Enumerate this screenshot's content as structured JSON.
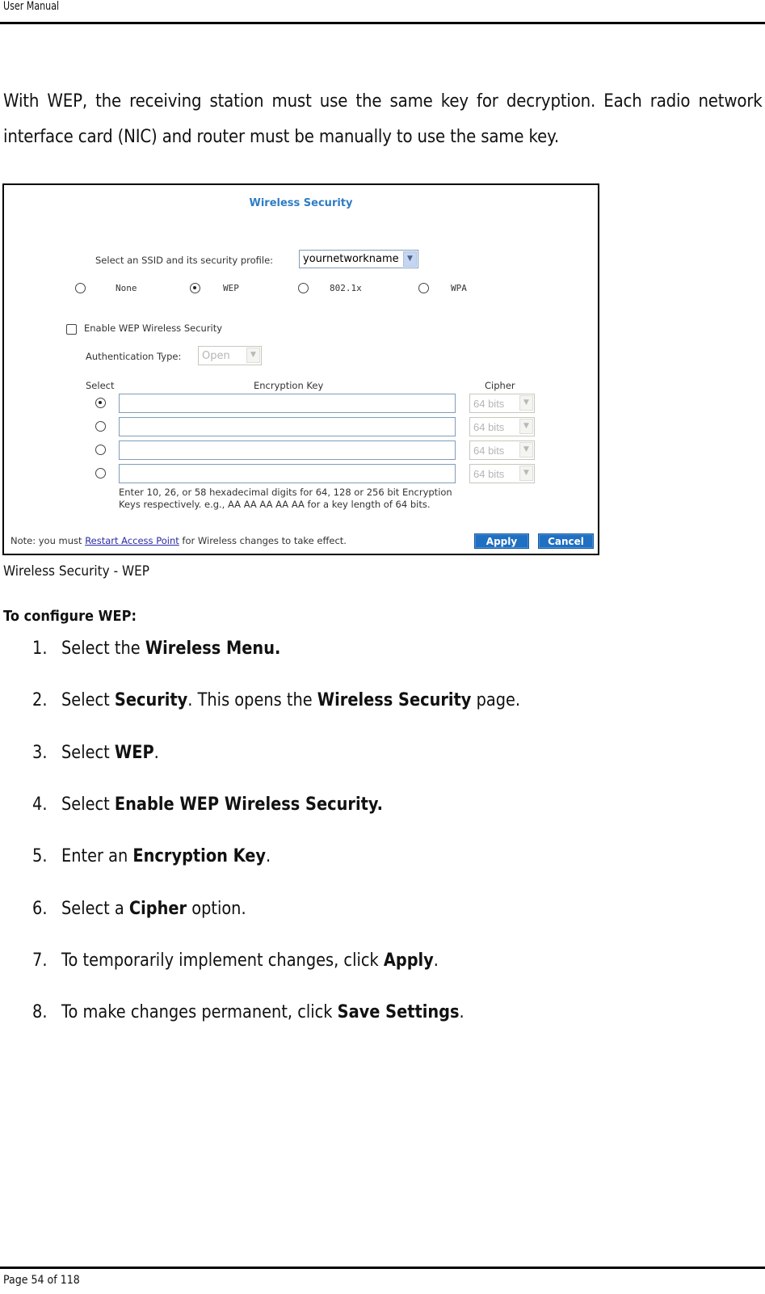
{
  "header": {
    "title": "User Manual"
  },
  "intro": "With WEP, the receiving station must use the same key for decryption. Each radio network interface card (NIC) and router must be manually to use the same key.",
  "screenshot": {
    "title": "Wireless Security",
    "ssid_label": "Select an SSID and its security profile:",
    "ssid_value": "yournetworkname",
    "security_modes": [
      {
        "label": "None",
        "checked": false
      },
      {
        "label": "WEP",
        "checked": true
      },
      {
        "label": "802.1x",
        "checked": false
      },
      {
        "label": "WPA",
        "checked": false
      }
    ],
    "enable_label": "Enable WEP Wireless Security",
    "enable_checked": false,
    "auth_label": "Authentication Type:",
    "auth_value": "Open",
    "columns": {
      "select": "Select",
      "key": "Encryption Key",
      "cipher": "Cipher"
    },
    "keys": [
      {
        "selected": true,
        "value": "",
        "cipher": "64 bits"
      },
      {
        "selected": false,
        "value": "",
        "cipher": "64 bits"
      },
      {
        "selected": false,
        "value": "",
        "cipher": "64 bits"
      },
      {
        "selected": false,
        "value": "",
        "cipher": "64 bits"
      }
    ],
    "hint": "Enter 10, 26, or 58 hexadecimal digits for 64, 128 or 256 bit Encryption Keys respectively. e.g., AA AA AA AA AA for a key length of 64 bits.",
    "note_prefix": "Note: you must ",
    "note_link": "Restart Access Point",
    "note_suffix": " for Wireless changes to take effect.",
    "apply_label": "Apply",
    "cancel_label": "Cancel",
    "accent_color": "#2f7cc4",
    "button_color": "#1f6fc2"
  },
  "caption": "Wireless Security - WEP",
  "subhead": "To configure WEP:",
  "steps": [
    {
      "num": "1.",
      "parts": [
        {
          "t": "Select the "
        },
        {
          "t": "Wireless Menu.",
          "b": true
        }
      ]
    },
    {
      "num": "2.",
      "parts": [
        {
          "t": "Select "
        },
        {
          "t": "Security",
          "b": true
        },
        {
          "t": ". This opens the "
        },
        {
          "t": "Wireless Security",
          "b": true
        },
        {
          "t": " page."
        }
      ]
    },
    {
      "num": "3.",
      "parts": [
        {
          "t": "Select "
        },
        {
          "t": "WEP",
          "b": true
        },
        {
          "t": "."
        }
      ]
    },
    {
      "num": "4.",
      "parts": [
        {
          "t": "Select "
        },
        {
          "t": "Enable WEP Wireless Security.",
          "b": true
        }
      ]
    },
    {
      "num": "5.",
      "parts": [
        {
          "t": "Enter an "
        },
        {
          "t": "Encryption Key",
          "b": true
        },
        {
          "t": "."
        }
      ]
    },
    {
      "num": "6.",
      "parts": [
        {
          "t": "Select a "
        },
        {
          "t": "Cipher",
          "b": true
        },
        {
          "t": " option."
        }
      ]
    },
    {
      "num": "7.",
      "parts": [
        {
          "t": "To temporarily implement changes, click "
        },
        {
          "t": "Apply",
          "b": true
        },
        {
          "t": "."
        }
      ]
    },
    {
      "num": "8.",
      "parts": [
        {
          "t": "To make changes permanent, click "
        },
        {
          "t": "Save Settings",
          "b": true
        },
        {
          "t": "."
        }
      ]
    }
  ],
  "footer": {
    "page_label": "Page 54  of 118"
  }
}
